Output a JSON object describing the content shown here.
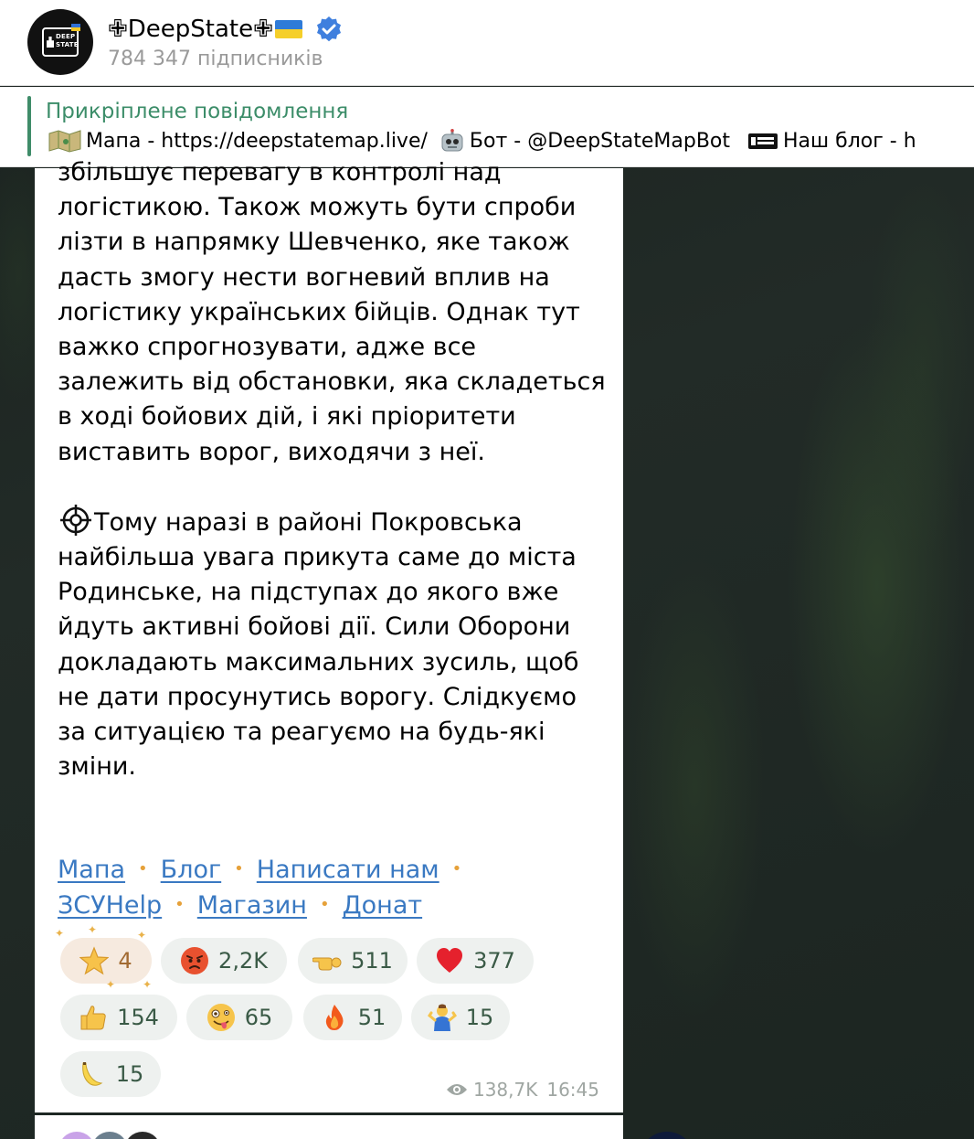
{
  "channel": {
    "name": "✙DeepState✙",
    "subscribers": "784 347 підписників",
    "avatar_logo_text": "DEEP STATE"
  },
  "pinned": {
    "title": "Прикріплене повідомлення",
    "map_text": "Мапа - https://deepstatemap.live/",
    "bot_text": "Бот - @DeepStateMapBot",
    "blog_text": "Наш блог - h"
  },
  "message": {
    "para1": "збільшує перевагу в контролі над логістикою. Також можуть бути спроби лізти в напрямку Шевченко, яке також дасть змогу нести вогневий вплив на логістику українських бійців. Однак тут важко спрогнозувати, адже все залежить від обстановки, яка складеться в ході бойових дій, і які пріоритети виставить ворог, виходячи з неї.",
    "para2": "Тому наразі в районі Покровська найбільша увага прикута саме до міста Родинське, на підступах до якого вже йдуть активні бойові дії. Сили Оборони докладають максимальних зусиль, щоб не дати просунутись ворогу. Слідкуємо за ситуацією та реагуємо на будь-які зміни.",
    "links": [
      "Мапа",
      "Блог",
      "Написати нам",
      "ЗСУHelp",
      "Магазин",
      "Донат"
    ],
    "views": "138,7K",
    "time": "16:45"
  },
  "reactions": [
    {
      "emoji": "star-icon",
      "count": "4"
    },
    {
      "emoji": "angry-face-icon",
      "count": "2,2K"
    },
    {
      "emoji": "pointing-hand-icon",
      "count": "511"
    },
    {
      "emoji": "red-heart-icon",
      "count": "377"
    },
    {
      "emoji": "thumbs-up-icon",
      "count": "154"
    },
    {
      "emoji": "zany-face-icon",
      "count": "65"
    },
    {
      "emoji": "fire-icon",
      "count": "51"
    },
    {
      "emoji": "person-shrugging-icon",
      "count": "15"
    },
    {
      "emoji": "banana-icon",
      "count": "15"
    }
  ],
  "colors": {
    "accent_green": "#3c8d69",
    "link_blue": "#3a79c2",
    "reaction_bg": "#eef1ef",
    "reaction_text": "#3a5a46",
    "meta_gray": "#9fa6a2"
  }
}
